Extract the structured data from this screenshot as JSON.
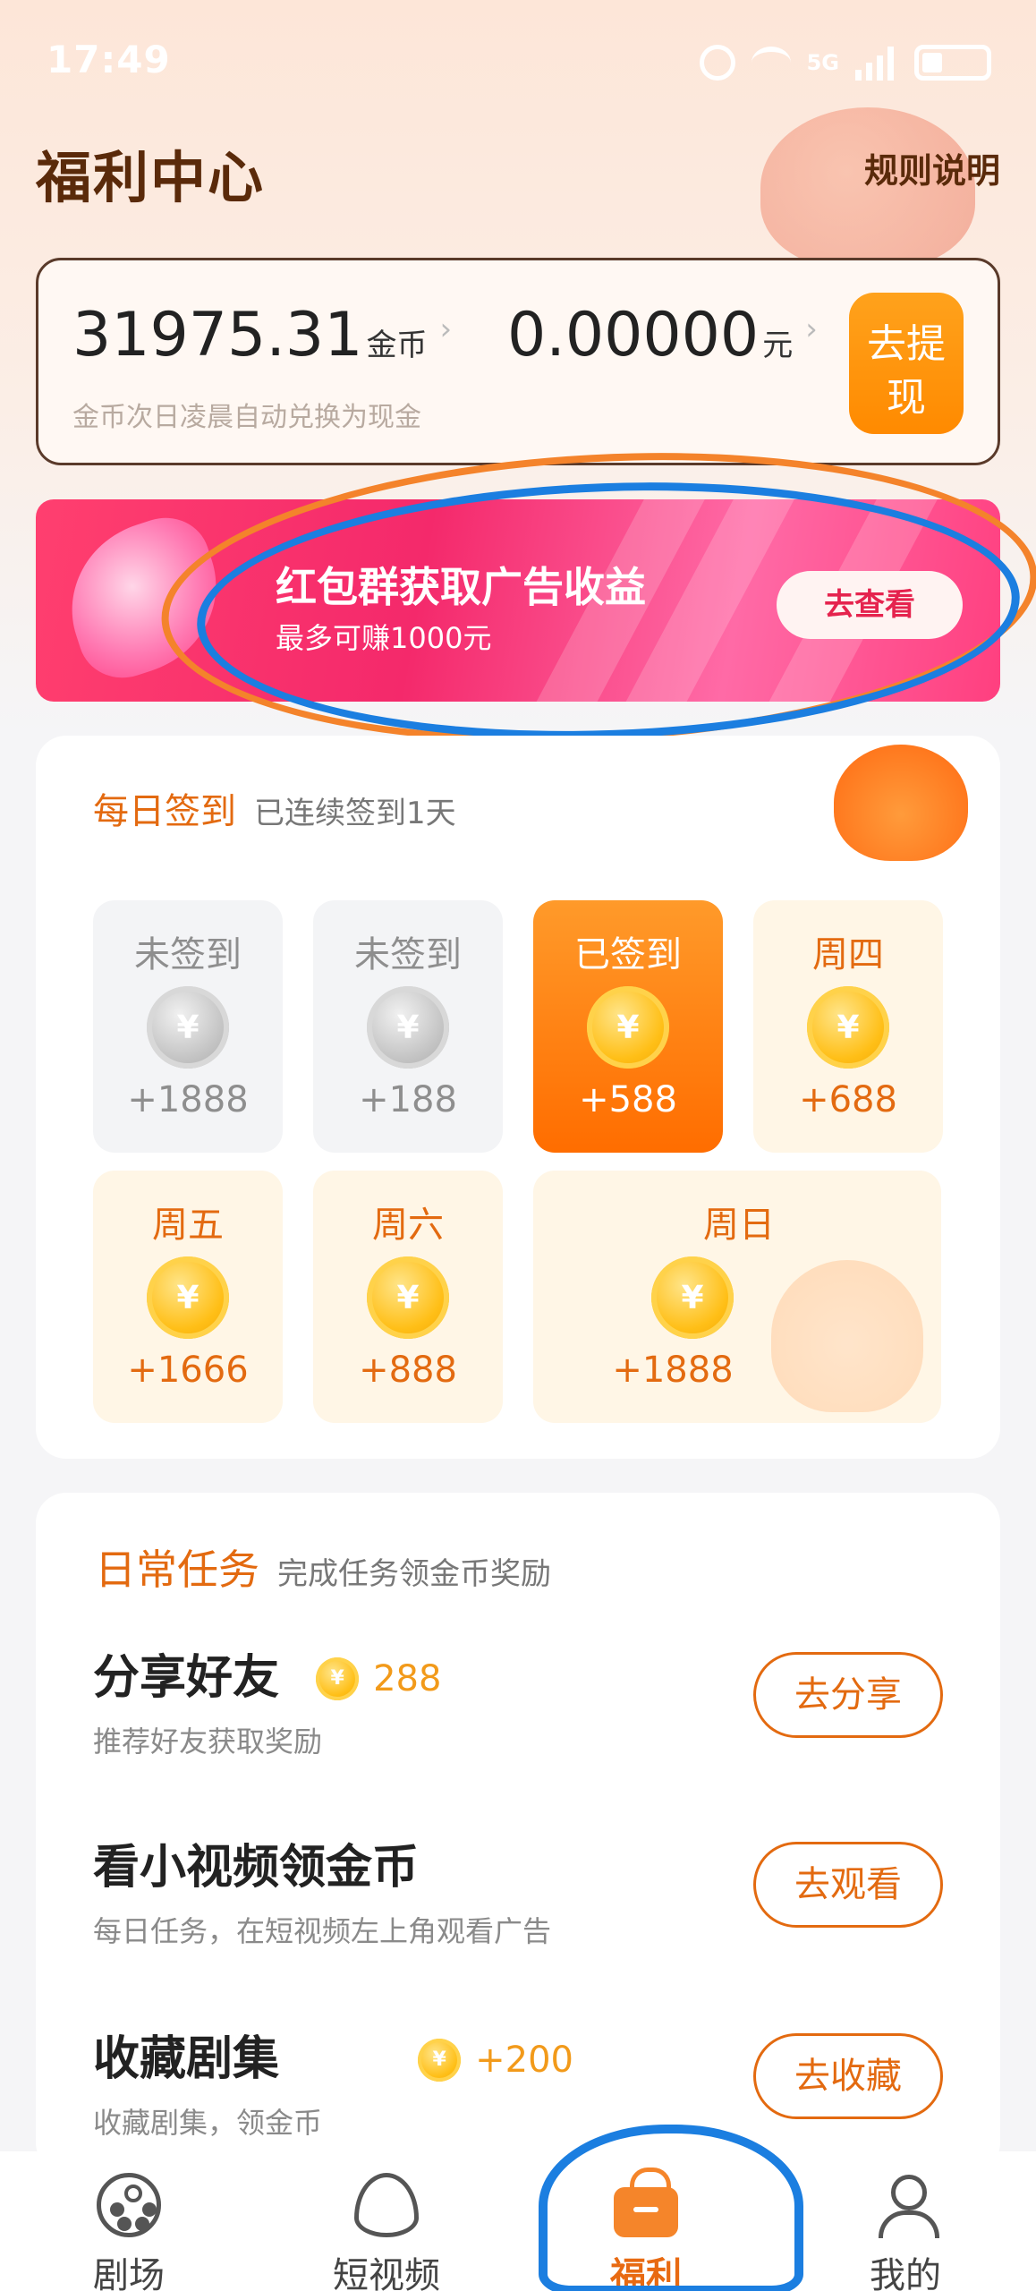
{
  "status_bar": {
    "time": "17:49",
    "network": "5G"
  },
  "header": {
    "title": "福利中心",
    "rules": "规则说明"
  },
  "balance": {
    "coins": "31975.31",
    "coin_unit": "金币",
    "cash": "0.00000",
    "cash_unit": "元",
    "note": "金币次日凌晨自动兑换为现金",
    "withdraw_label": "去提现"
  },
  "banner": {
    "title": "红包群获取广告收益",
    "subtitle": "最多可赚1000元",
    "button": "去查看"
  },
  "signin": {
    "title": "每日签到",
    "subtitle": "已连续签到1天",
    "coin_symbol": "¥",
    "days": [
      {
        "label": "未签到",
        "amount": "+1888",
        "state": "missed"
      },
      {
        "label": "未签到",
        "amount": "+188",
        "state": "missed"
      },
      {
        "label": "已签到",
        "amount": "+588",
        "state": "done"
      },
      {
        "label": "周四",
        "amount": "+688",
        "state": "upcoming"
      },
      {
        "label": "周五",
        "amount": "+1666",
        "state": "upcoming"
      },
      {
        "label": "周六",
        "amount": "+888",
        "state": "upcoming"
      },
      {
        "label": "周日",
        "amount": "+1888",
        "state": "upcoming"
      }
    ]
  },
  "tasks": {
    "title": "日常任务",
    "subtitle": "完成任务领金币奖励",
    "items": [
      {
        "title": "分享好友",
        "reward": "288",
        "desc": "推荐好友获取奖励",
        "button": "去分享"
      },
      {
        "title": "看小视频领金币",
        "reward": "",
        "desc": "每日任务，在短视频左上角观看广告",
        "button": "去观看"
      },
      {
        "title": "收藏剧集",
        "reward": "+200",
        "desc": "收藏剧集，领金币",
        "button": "去收藏"
      }
    ]
  },
  "nav": {
    "items": [
      {
        "label": "剧场",
        "icon": "film-reel-icon"
      },
      {
        "label": "短视频",
        "icon": "flame-icon"
      },
      {
        "label": "福利",
        "icon": "gift-bag-icon",
        "active": true
      },
      {
        "label": "我的",
        "icon": "user-icon"
      }
    ]
  },
  "colors": {
    "accent": "#e36a10",
    "banner": "#f4296b",
    "annotation_blue": "#1b7ee0",
    "annotation_orange": "#f4832b"
  }
}
